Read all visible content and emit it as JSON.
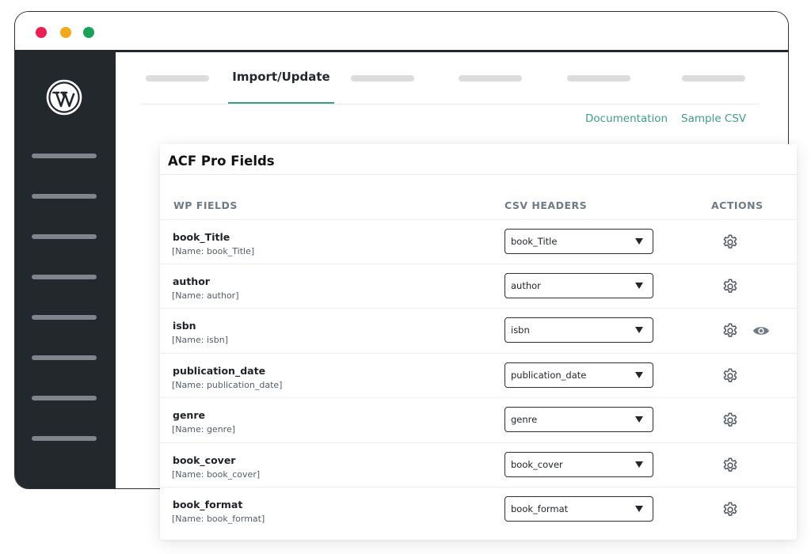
{
  "window": {
    "controls": [
      "close",
      "minimize",
      "maximize"
    ]
  },
  "tabs": {
    "active_label": "Import/Update"
  },
  "links": {
    "documentation": "Documentation",
    "sample_csv": "Sample CSV"
  },
  "card": {
    "title": "ACF Pro Fields",
    "columns": {
      "wp_fields": "WP FIELDS",
      "csv_headers": "CSV HEADERS",
      "actions": "ACTIONS"
    },
    "rows": [
      {
        "name": "book_Title",
        "sub": "[Name: book_Title]",
        "csv": "book_Title"
      },
      {
        "name": "author",
        "sub": "[Name: author]",
        "csv": "author"
      },
      {
        "name": "isbn",
        "sub": "[Name: isbn]",
        "csv": "isbn"
      },
      {
        "name": "publication_date",
        "sub": "[Name: publication_date]",
        "csv": "publication_date"
      },
      {
        "name": "genre",
        "sub": "[Name: genre]",
        "csv": "genre"
      },
      {
        "name": "book_cover",
        "sub": "[Name: book_cover]",
        "csv": "book_cover"
      },
      {
        "name": "book_format",
        "sub": "[Name: book_format]",
        "csv": "book_format"
      }
    ]
  },
  "icons": {
    "logo": "wordpress-logo-icon",
    "row_action": "gear-icon",
    "preview": "eye-icon",
    "dropdown": "chevron-down-icon"
  },
  "colors": {
    "accent": "#3f9e87",
    "sidebar": "#23282d",
    "close_dot": "#ee1d52",
    "minimize_dot": "#f4a81b",
    "maximize_dot": "#1aa25a"
  }
}
